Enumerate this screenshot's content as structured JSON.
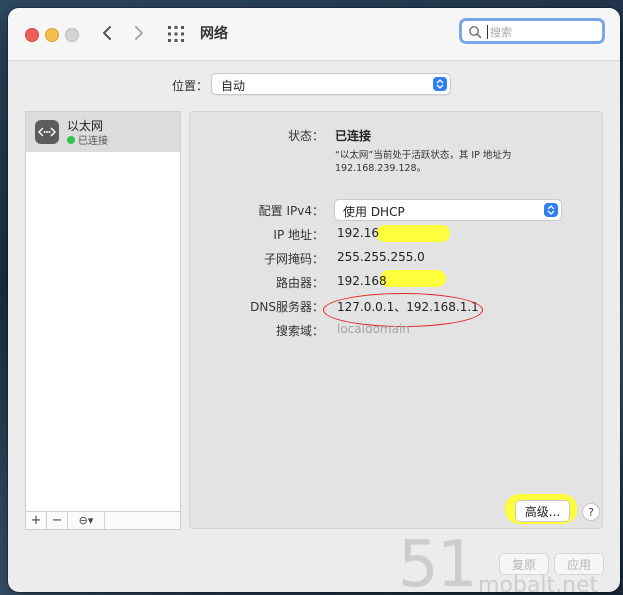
{
  "window": {
    "title": "网络"
  },
  "search": {
    "placeholder": "搜索"
  },
  "location": {
    "label": "位置：",
    "value": "自动"
  },
  "sidebar": {
    "items": [
      {
        "name": "以太网",
        "status": "已连接",
        "status_color": "#35c24a"
      }
    ],
    "tools": {
      "add": "+",
      "remove": "−",
      "action": "⊖▾"
    }
  },
  "detail": {
    "status_label": "状态：",
    "status_value": "已连接",
    "status_description": "“以太网”当前处于活跃状态，其 IP 地址为 192.168.239.128。",
    "ipv4_label": "配置 IPv4：",
    "ipv4_value": "使用 DHCP",
    "ip_label": "IP 地址：",
    "ip_value": "192.16",
    "subnet_label": "子网掩码：",
    "subnet_value": "255.255.255.0",
    "router_label": "路由器：",
    "router_value": "192.168",
    "dns_label": "DNS服务器：",
    "dns_value": "127.0.0.1、192.168.1.1",
    "search_domain_label": "搜索域：",
    "search_domain_value": "localdomain"
  },
  "buttons": {
    "advanced": "高级...",
    "help": "?",
    "revert": "复原",
    "apply": "应用"
  },
  "watermark": {
    "main": "51",
    "sub": "mobalt.net"
  },
  "colors": {
    "accent": "#2f7ff1",
    "highlight": "#ffff33",
    "annotation_red": "#e02222"
  }
}
